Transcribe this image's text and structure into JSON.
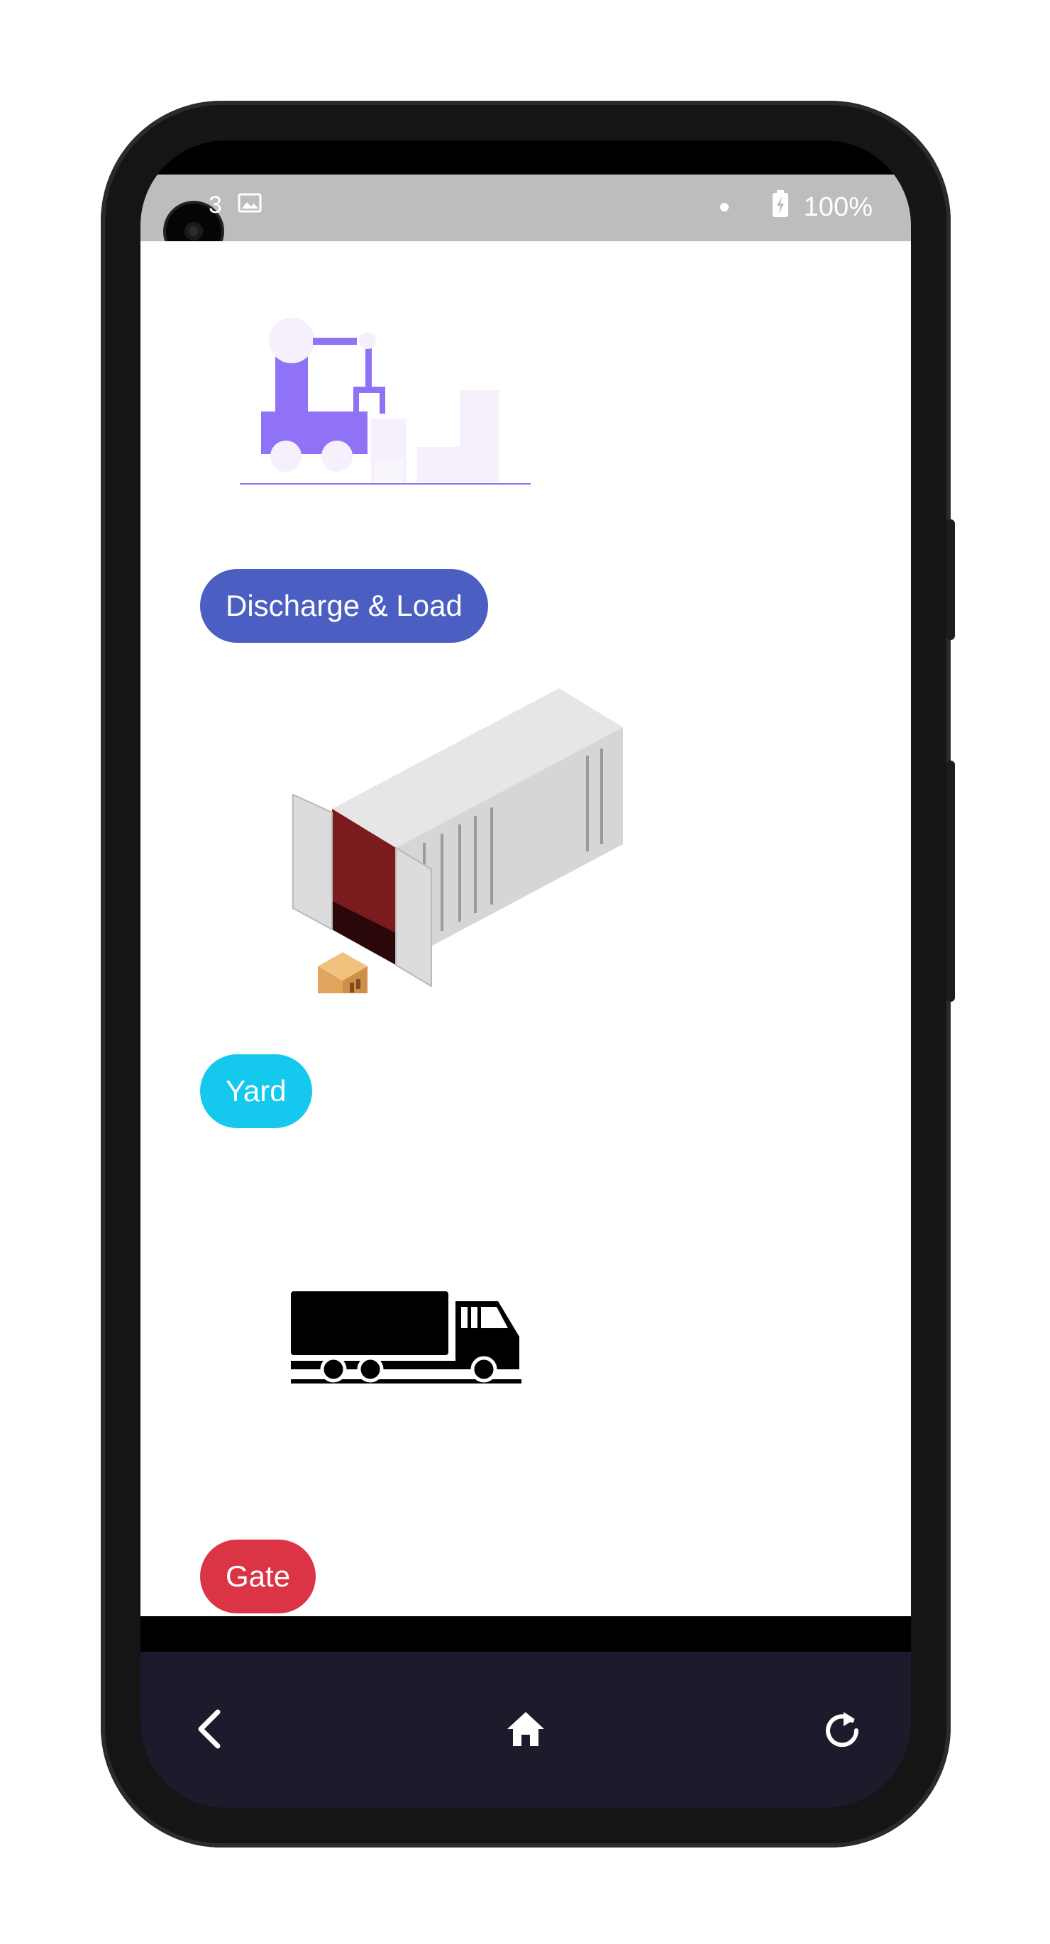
{
  "statusbar": {
    "left_icons": [
      "sim-icon",
      "image-icon"
    ],
    "left_text": "3",
    "battery": "100%"
  },
  "menu": {
    "discharge_load_label": "Discharge & Load",
    "yard_label": "Yard",
    "gate_label": "Gate"
  },
  "colors": {
    "discharge_load": "#4a5fc1",
    "yard": "#15c8ee",
    "gate": "#db3545",
    "crane": "#8f72f6",
    "navbar": "#1d1a2b",
    "statusbar": "#bdbdbd"
  },
  "navigation": {
    "back_icon": "chevron-left-icon",
    "home_icon": "home-icon",
    "refresh_icon": "refresh-icon"
  }
}
